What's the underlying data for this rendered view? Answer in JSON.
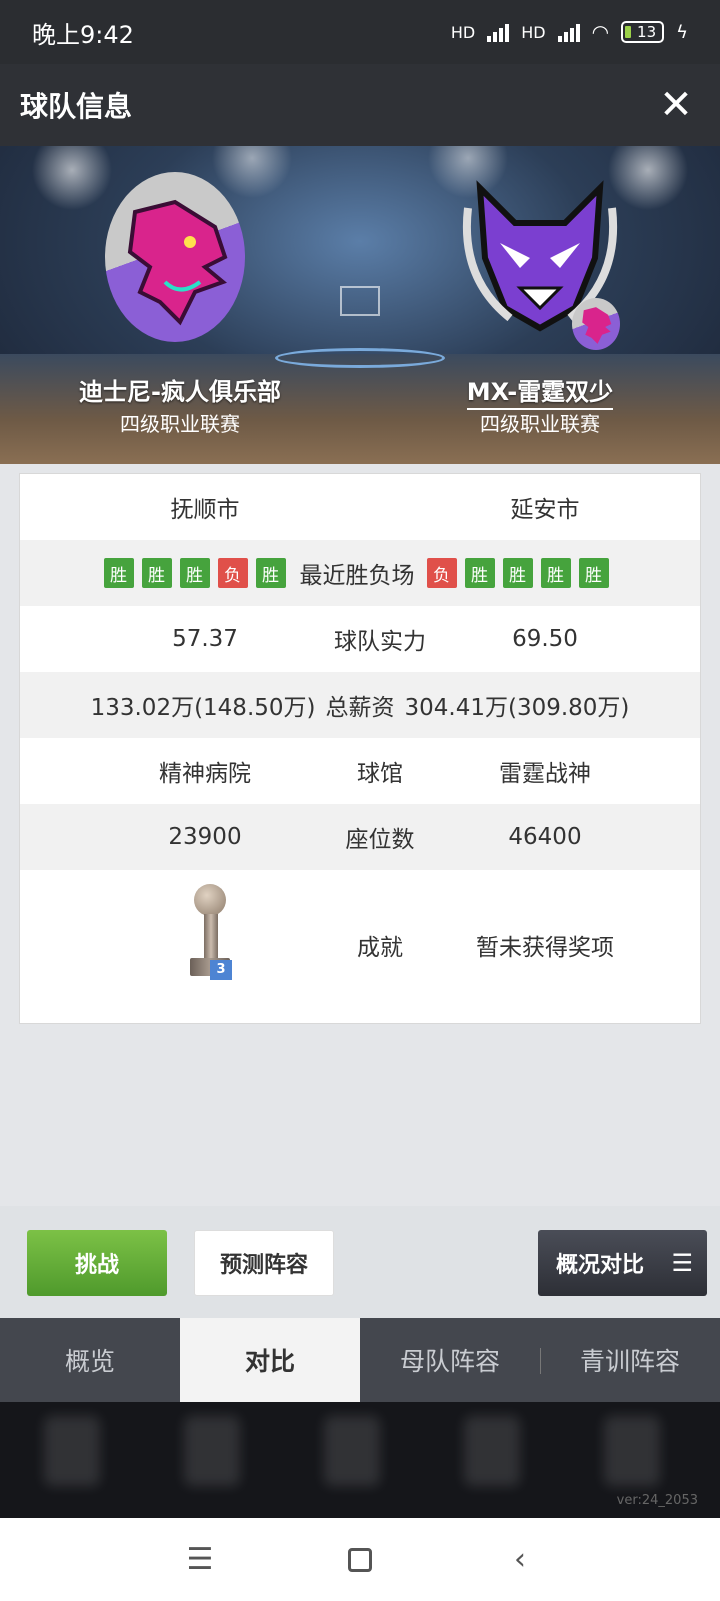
{
  "status_bar": {
    "time": "晚上9:42",
    "battery": "13",
    "net1": "HD",
    "net2": "HD"
  },
  "header": {
    "title": "球队信息",
    "close_symbol": "✕"
  },
  "teams": {
    "left": {
      "name": "迪士尼-疯人俱乐部",
      "league": "四级职业联赛"
    },
    "right": {
      "name": "MX-雷霆双少",
      "league": "四级职业联赛"
    }
  },
  "compare": {
    "cities": {
      "left": "抚顺市",
      "right": "延安市"
    },
    "record": {
      "label": "最近胜负场",
      "left": [
        "胜",
        "胜",
        "胜",
        "负",
        "胜"
      ],
      "right": [
        "负",
        "胜",
        "胜",
        "胜",
        "胜"
      ]
    },
    "strength": {
      "label": "球队实力",
      "left": "57.37",
      "right": "69.50"
    },
    "salary": {
      "label": "总薪资",
      "left": "133.02万(148.50万)",
      "right": "304.41万(309.80万)"
    },
    "arena": {
      "label": "球馆",
      "left": "精神病院",
      "right": "雷霆战神"
    },
    "seats": {
      "label": "座位数",
      "left": "23900",
      "right": "46400"
    },
    "achievements": {
      "label": "成就",
      "left_trophy_count": "3",
      "right": "暂未获得奖项"
    }
  },
  "actions": {
    "challenge": "挑战",
    "predict": "预测阵容",
    "compare": "概况对比",
    "menu_symbol": "☰"
  },
  "tabs": [
    "概览",
    "对比",
    "母队阵容",
    "青训阵容"
  ],
  "active_tab": "对比",
  "version": "ver:24_2053",
  "colors": {
    "win": "#46a33d",
    "loss": "#e0504a",
    "challenge_green": "#5fa935",
    "dark_header": "#2f3136"
  }
}
